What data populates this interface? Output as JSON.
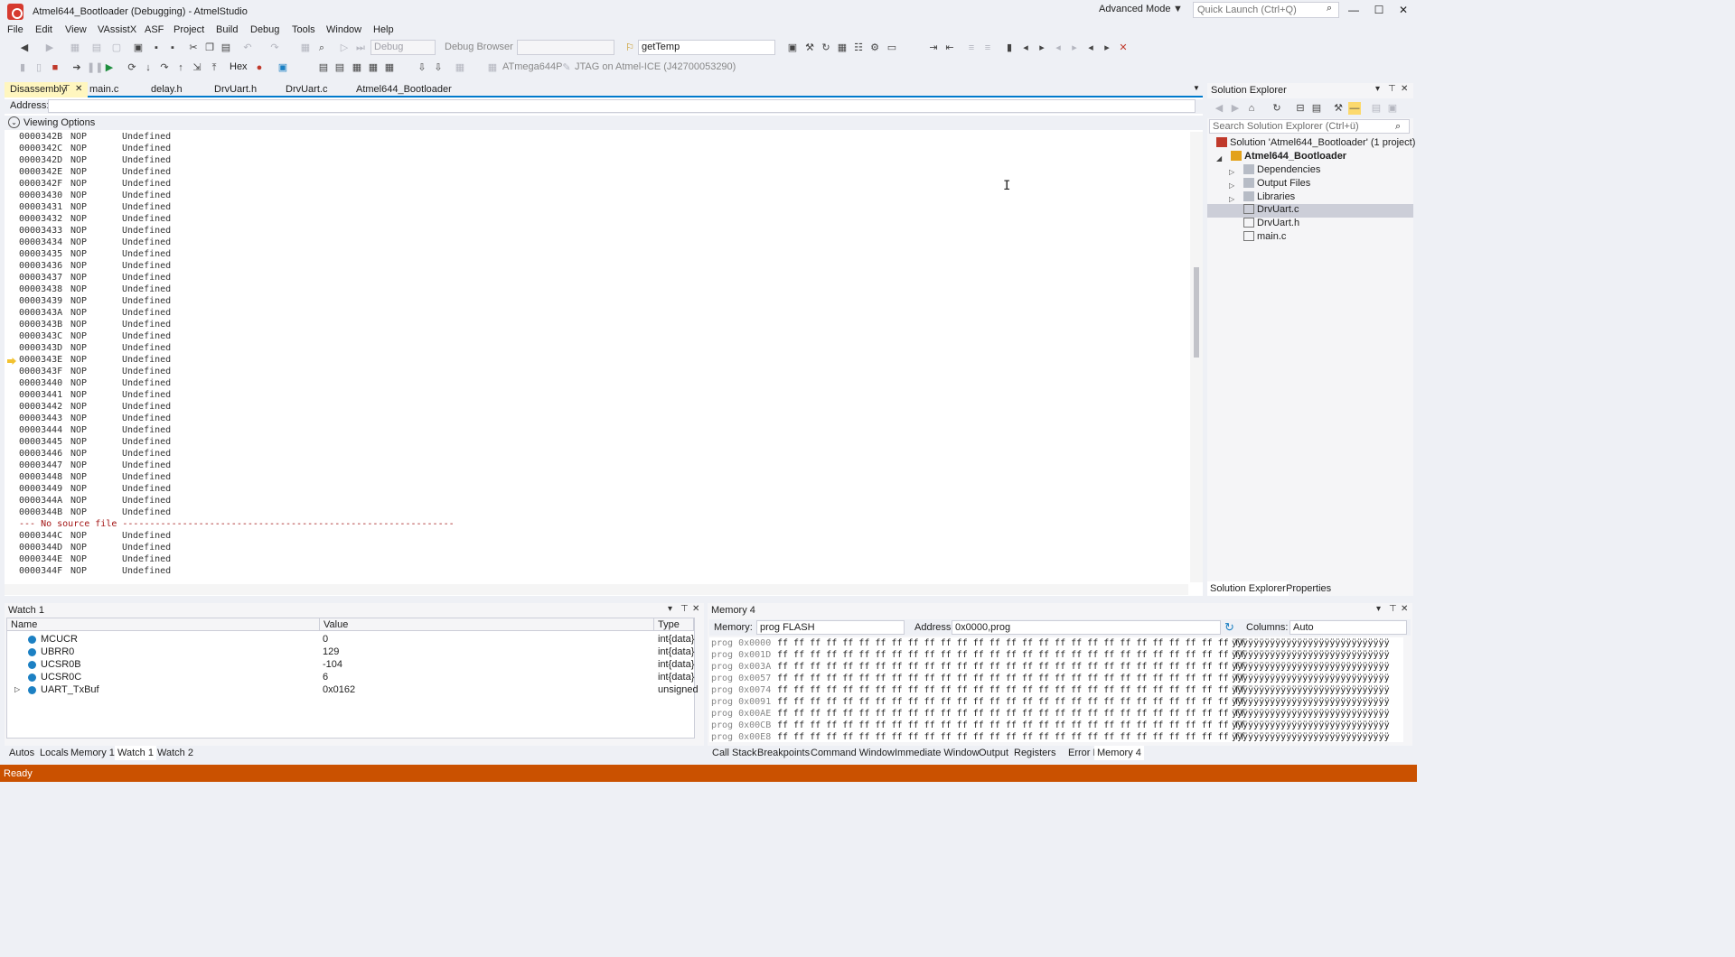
{
  "window": {
    "title": "Atmel644_Bootloader (Debugging) - AtmelStudio",
    "mode_label": "Advanced Mode",
    "quick_launch_placeholder": "Quick Launch (Ctrl+Q)"
  },
  "menu": [
    "File",
    "Edit",
    "View",
    "VAssistX",
    "ASF",
    "Project",
    "Build",
    "Debug",
    "Tools",
    "Window",
    "Help"
  ],
  "toolbar": {
    "config_combo": "Debug",
    "debug_browser": "Debug Browser",
    "function_combo": "getTemp",
    "hex_label": "Hex",
    "device_label": "ATmega644P",
    "tool_label": "JTAG on Atmel-ICE (J42700053290)"
  },
  "doc_tabs": [
    "Disassembly",
    "main.c",
    "delay.h",
    "DrvUart.h",
    "DrvUart.c",
    "Atmel644_Bootloader"
  ],
  "disassembly": {
    "address_label": "Address:",
    "viewing_options": "Viewing Options",
    "rows_before": [
      {
        "addr": "0000342B",
        "mn": "NOP",
        "op": "Undefined"
      },
      {
        "addr": "0000342C",
        "mn": "NOP",
        "op": "Undefined"
      },
      {
        "addr": "0000342D",
        "mn": "NOP",
        "op": "Undefined"
      },
      {
        "addr": "0000342E",
        "mn": "NOP",
        "op": "Undefined"
      },
      {
        "addr": "0000342F",
        "mn": "NOP",
        "op": "Undefined"
      },
      {
        "addr": "00003430",
        "mn": "NOP",
        "op": "Undefined"
      },
      {
        "addr": "00003431",
        "mn": "NOP",
        "op": "Undefined"
      },
      {
        "addr": "00003432",
        "mn": "NOP",
        "op": "Undefined"
      },
      {
        "addr": "00003433",
        "mn": "NOP",
        "op": "Undefined"
      },
      {
        "addr": "00003434",
        "mn": "NOP",
        "op": "Undefined"
      },
      {
        "addr": "00003435",
        "mn": "NOP",
        "op": "Undefined"
      },
      {
        "addr": "00003436",
        "mn": "NOP",
        "op": "Undefined"
      },
      {
        "addr": "00003437",
        "mn": "NOP",
        "op": "Undefined"
      },
      {
        "addr": "00003438",
        "mn": "NOP",
        "op": "Undefined"
      },
      {
        "addr": "00003439",
        "mn": "NOP",
        "op": "Undefined"
      },
      {
        "addr": "0000343A",
        "mn": "NOP",
        "op": "Undefined"
      },
      {
        "addr": "0000343B",
        "mn": "NOP",
        "op": "Undefined"
      },
      {
        "addr": "0000343C",
        "mn": "NOP",
        "op": "Undefined"
      },
      {
        "addr": "0000343D",
        "mn": "NOP",
        "op": "Undefined"
      },
      {
        "addr": "0000343E",
        "mn": "NOP",
        "op": "Undefined"
      },
      {
        "addr": "0000343F",
        "mn": "NOP",
        "op": "Undefined"
      },
      {
        "addr": "00003440",
        "mn": "NOP",
        "op": "Undefined"
      },
      {
        "addr": "00003441",
        "mn": "NOP",
        "op": "Undefined"
      },
      {
        "addr": "00003442",
        "mn": "NOP",
        "op": "Undefined"
      },
      {
        "addr": "00003443",
        "mn": "NOP",
        "op": "Undefined"
      },
      {
        "addr": "00003444",
        "mn": "NOP",
        "op": "Undefined"
      },
      {
        "addr": "00003445",
        "mn": "NOP",
        "op": "Undefined"
      },
      {
        "addr": "00003446",
        "mn": "NOP",
        "op": "Undefined"
      },
      {
        "addr": "00003447",
        "mn": "NOP",
        "op": "Undefined"
      },
      {
        "addr": "00003448",
        "mn": "NOP",
        "op": "Undefined"
      },
      {
        "addr": "00003449",
        "mn": "NOP",
        "op": "Undefined"
      },
      {
        "addr": "0000344A",
        "mn": "NOP",
        "op": "Undefined"
      },
      {
        "addr": "0000344B",
        "mn": "NOP",
        "op": "Undefined"
      }
    ],
    "source_marker": "--- No source file -------------------------------------------------------------",
    "rows_after": [
      {
        "addr": "0000344C",
        "mn": "NOP",
        "op": "Undefined"
      },
      {
        "addr": "0000344D",
        "mn": "NOP",
        "op": "Undefined"
      },
      {
        "addr": "0000344E",
        "mn": "NOP",
        "op": "Undefined"
      },
      {
        "addr": "0000344F",
        "mn": "NOP",
        "op": "Undefined"
      }
    ],
    "current_addr": "0000343E"
  },
  "solution_explorer": {
    "title": "Solution Explorer",
    "search_placeholder": "Search Solution Explorer (Ctrl+ü)",
    "solution": "Solution 'Atmel644_Bootloader' (1 project)",
    "project": "Atmel644_Bootloader",
    "folders": [
      "Dependencies",
      "Output Files",
      "Libraries"
    ],
    "files": [
      "DrvUart.c",
      "DrvUart.h",
      "main.c"
    ],
    "tabs": [
      "Solution Explorer",
      "Properties"
    ]
  },
  "watch": {
    "title": "Watch 1",
    "columns": [
      "Name",
      "Value",
      "Type"
    ],
    "rows": [
      {
        "name": "MCUCR",
        "value": "0",
        "type": "int{data}"
      },
      {
        "name": "UBRR0",
        "value": "129",
        "type": "int{data}"
      },
      {
        "name": "UCSR0B",
        "value": "-104",
        "type": "int{data}"
      },
      {
        "name": "UCSR0C",
        "value": "6",
        "type": "int{data}"
      },
      {
        "name": "UART_TxBuf",
        "value": "0x0162",
        "type": "unsigned"
      }
    ]
  },
  "left_bottom_tabs": [
    "Autos",
    "Locals",
    "Memory 1",
    "Watch 1",
    "Watch 2"
  ],
  "memory": {
    "title": "Memory 4",
    "memory_label": "Memory:",
    "memory_value": "prog FLASH",
    "address_label": "Address:",
    "address_value": "0x0000,prog",
    "columns_label": "Columns:",
    "columns_value": "Auto",
    "rows": [
      {
        "addr": "prog 0x0000",
        "hex": "ff ff ff ff ff ff ff ff ff ff ff ff ff ff ff ff ff ff ff ff ff ff ff ff ff ff ff ff ff",
        "ascii": "ÿÿÿÿÿÿÿÿÿÿÿÿÿÿÿÿÿÿÿÿÿÿÿÿÿÿÿÿÿ"
      },
      {
        "addr": "prog 0x001D",
        "hex": "ff ff ff ff ff ff ff ff ff ff ff ff ff ff ff ff ff ff ff ff ff ff ff ff ff ff ff ff ff",
        "ascii": "ÿÿÿÿÿÿÿÿÿÿÿÿÿÿÿÿÿÿÿÿÿÿÿÿÿÿÿÿÿ"
      },
      {
        "addr": "prog 0x003A",
        "hex": "ff ff ff ff ff ff ff ff ff ff ff ff ff ff ff ff ff ff ff ff ff ff ff ff ff ff ff ff ff",
        "ascii": "ÿÿÿÿÿÿÿÿÿÿÿÿÿÿÿÿÿÿÿÿÿÿÿÿÿÿÿÿÿ"
      },
      {
        "addr": "prog 0x0057",
        "hex": "ff ff ff ff ff ff ff ff ff ff ff ff ff ff ff ff ff ff ff ff ff ff ff ff ff ff ff ff ff",
        "ascii": "ÿÿÿÿÿÿÿÿÿÿÿÿÿÿÿÿÿÿÿÿÿÿÿÿÿÿÿÿÿ"
      },
      {
        "addr": "prog 0x0074",
        "hex": "ff ff ff ff ff ff ff ff ff ff ff ff ff ff ff ff ff ff ff ff ff ff ff ff ff ff ff ff ff",
        "ascii": "ÿÿÿÿÿÿÿÿÿÿÿÿÿÿÿÿÿÿÿÿÿÿÿÿÿÿÿÿÿ"
      },
      {
        "addr": "prog 0x0091",
        "hex": "ff ff ff ff ff ff ff ff ff ff ff ff ff ff ff ff ff ff ff ff ff ff ff ff ff ff ff ff ff",
        "ascii": "ÿÿÿÿÿÿÿÿÿÿÿÿÿÿÿÿÿÿÿÿÿÿÿÿÿÿÿÿÿ"
      },
      {
        "addr": "prog 0x00AE",
        "hex": "ff ff ff ff ff ff ff ff ff ff ff ff ff ff ff ff ff ff ff ff ff ff ff ff ff ff ff ff ff",
        "ascii": "ÿÿÿÿÿÿÿÿÿÿÿÿÿÿÿÿÿÿÿÿÿÿÿÿÿÿÿÿÿ"
      },
      {
        "addr": "prog 0x00CB",
        "hex": "ff ff ff ff ff ff ff ff ff ff ff ff ff ff ff ff ff ff ff ff ff ff ff ff ff ff ff ff ff",
        "ascii": "ÿÿÿÿÿÿÿÿÿÿÿÿÿÿÿÿÿÿÿÿÿÿÿÿÿÿÿÿÿ"
      },
      {
        "addr": "prog 0x00E8",
        "hex": "ff ff ff ff ff ff ff ff ff ff ff ff ff ff ff ff ff ff ff ff ff ff ff ff ff ff ff ff ff",
        "ascii": "ÿÿÿÿÿÿÿÿÿÿÿÿÿÿÿÿÿÿÿÿÿÿÿÿÿÿÿÿÿ"
      }
    ]
  },
  "right_bottom_tabs": [
    "Call Stack",
    "Breakpoints",
    "Command Window",
    "Immediate Window",
    "Output",
    "Registers",
    "Error List",
    "Memory 4"
  ],
  "status": {
    "text": "Ready"
  },
  "colors": {
    "accent": "#007acc",
    "status_bar": "#ca5100",
    "active_tab": "#fff6bf"
  }
}
